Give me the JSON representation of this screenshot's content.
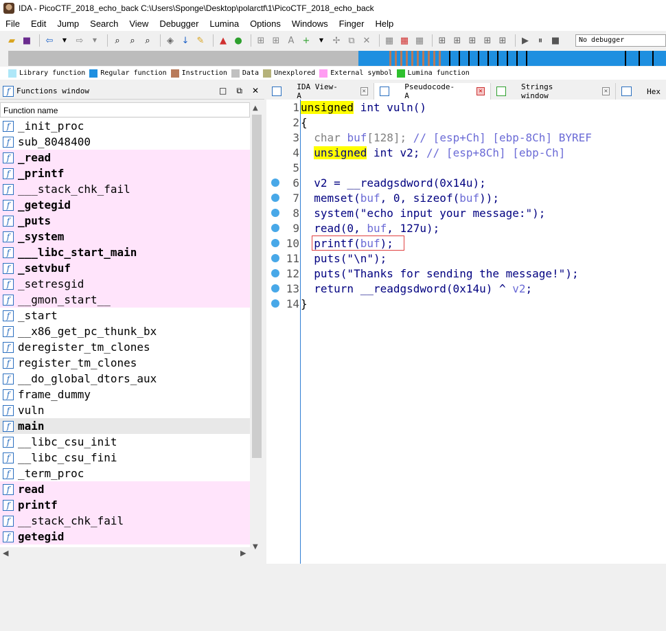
{
  "window": {
    "title": "IDA - PicoCTF_2018_echo_back C:\\Users\\Sponge\\Desktop\\polarctf\\1\\PicoCTF_2018_echo_back"
  },
  "menu": [
    "File",
    "Edit",
    "Jump",
    "Search",
    "View",
    "Debugger",
    "Lumina",
    "Options",
    "Windows",
    "Finger",
    "Help"
  ],
  "toolbar": {
    "debugger_select": "No debugger"
  },
  "legend": [
    {
      "label": "Library function",
      "color": "#aee7f8"
    },
    {
      "label": "Regular function",
      "color": "#1e8fe0"
    },
    {
      "label": "Instruction",
      "color": "#b87a5a"
    },
    {
      "label": "Data",
      "color": "#c0c0c0"
    },
    {
      "label": "Unexplored",
      "color": "#b5b27a"
    },
    {
      "label": "External symbol",
      "color": "#ff9cf2"
    },
    {
      "label": "Lumina function",
      "color": "#2ec02e"
    }
  ],
  "functions_window": {
    "title": "Functions window",
    "column_header": "Function name",
    "items": [
      {
        "name": "_init_proc",
        "style": "normal"
      },
      {
        "name": "sub_8048400",
        "style": "normal"
      },
      {
        "name": "_read",
        "style": "pink-bold"
      },
      {
        "name": "_printf",
        "style": "pink-bold"
      },
      {
        "name": "___stack_chk_fail",
        "style": "pink"
      },
      {
        "name": "_getegid",
        "style": "pink-bold"
      },
      {
        "name": "_puts",
        "style": "pink-bold"
      },
      {
        "name": "_system",
        "style": "pink-bold"
      },
      {
        "name": "___libc_start_main",
        "style": "pink-bold"
      },
      {
        "name": "_setvbuf",
        "style": "pink-bold"
      },
      {
        "name": "_setresgid",
        "style": "pink"
      },
      {
        "name": "__gmon_start__",
        "style": "pink"
      },
      {
        "name": "_start",
        "style": "normal"
      },
      {
        "name": "__x86_get_pc_thunk_bx",
        "style": "normal"
      },
      {
        "name": "deregister_tm_clones",
        "style": "normal"
      },
      {
        "name": "register_tm_clones",
        "style": "normal"
      },
      {
        "name": "__do_global_dtors_aux",
        "style": "normal"
      },
      {
        "name": "frame_dummy",
        "style": "normal"
      },
      {
        "name": "vuln",
        "style": "normal"
      },
      {
        "name": "main",
        "style": "selected-bold"
      },
      {
        "name": "__libc_csu_init",
        "style": "normal"
      },
      {
        "name": "__libc_csu_fini",
        "style": "normal"
      },
      {
        "name": "_term_proc",
        "style": "normal"
      },
      {
        "name": "read",
        "style": "pink-bold"
      },
      {
        "name": "printf",
        "style": "pink-bold"
      },
      {
        "name": "__stack_chk_fail",
        "style": "pink"
      },
      {
        "name": "getegid",
        "style": "pink-bold"
      }
    ]
  },
  "tabs": [
    {
      "label": "IDA View-A",
      "active": false
    },
    {
      "label": "Pseudocode-A",
      "active": true
    },
    {
      "label": "Strings window",
      "active": false
    },
    {
      "label": "Hex",
      "active": false
    }
  ],
  "pseudocode": {
    "lines": [
      {
        "n": "1",
        "bp": false
      },
      {
        "n": "2",
        "bp": false
      },
      {
        "n": "3",
        "bp": false
      },
      {
        "n": "4",
        "bp": false
      },
      {
        "n": "5",
        "bp": false
      },
      {
        "n": "6",
        "bp": true
      },
      {
        "n": "7",
        "bp": true
      },
      {
        "n": "8",
        "bp": true
      },
      {
        "n": "9",
        "bp": true
      },
      {
        "n": "10",
        "bp": true
      },
      {
        "n": "11",
        "bp": true
      },
      {
        "n": "12",
        "bp": true
      },
      {
        "n": "13",
        "bp": true
      },
      {
        "n": "14",
        "bp": true
      }
    ],
    "tokens": {
      "l1": [
        "unsigned",
        " int vuln()"
      ],
      "l2": [
        "{"
      ],
      "l3": [
        "  char ",
        "buf",
        "[128]; ",
        "// [esp+Ch] [ebp-8Ch] BYREF"
      ],
      "l4": [
        "  ",
        "unsigned",
        " int ",
        "v2",
        "; ",
        "// [esp+8Ch] [ebp-Ch]"
      ],
      "l6": [
        "  ",
        "v2",
        " = __readgsdword(0x14u);"
      ],
      "l7": [
        "  memset(",
        "buf",
        ", 0, sizeof(",
        "buf",
        "));"
      ],
      "l8": [
        "  system(\"echo input your message:\");"
      ],
      "l9": [
        "  read(0, ",
        "buf",
        ", 127u);"
      ],
      "l10": [
        "  printf(",
        "buf",
        ");"
      ],
      "l11": [
        "  puts(\"\\n\");"
      ],
      "l12": [
        "  puts(\"Thanks for sending the message!\");"
      ],
      "l13": [
        "  return __readgsdword(0x14u) ^ ",
        "v2",
        ";"
      ],
      "l14": [
        "}"
      ]
    }
  }
}
